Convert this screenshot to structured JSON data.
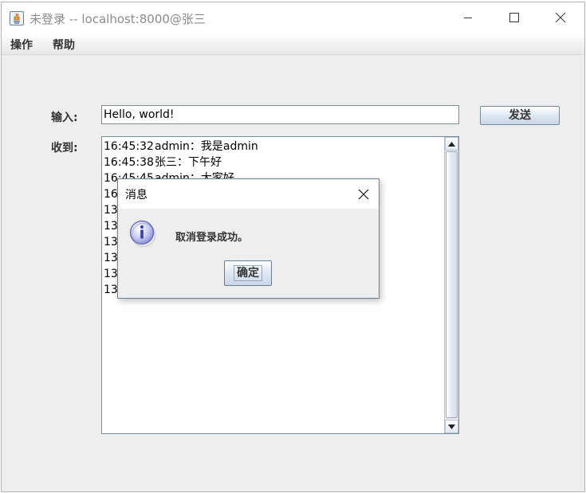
{
  "window": {
    "title": "未登录 -- localhost:8000@张三"
  },
  "menubar": {
    "items": [
      {
        "label": "操作"
      },
      {
        "label": "帮助"
      }
    ]
  },
  "form": {
    "input_label": "输入:",
    "input_value": "Hello, world!",
    "send_label": "发送",
    "recv_label": "收到:"
  },
  "messages": [
    {
      "time": "16:45:32",
      "text": "admin：我是admin"
    },
    {
      "time": "16:45:38",
      "text": "张三：下午好"
    },
    {
      "time": "16:45:45",
      "text": "admin：大家好"
    },
    {
      "time": "16",
      "text": ""
    },
    {
      "time": "13",
      "text": ""
    },
    {
      "time": "13",
      "text": ""
    },
    {
      "time": "13",
      "text": ""
    },
    {
      "time": "13",
      "text": ""
    },
    {
      "time": "13",
      "text": ""
    },
    {
      "time": "13",
      "text": ""
    }
  ],
  "dialog": {
    "title": "消息",
    "message": "取消登录成功。",
    "ok_label": "确定",
    "icon": "info-icon"
  }
}
